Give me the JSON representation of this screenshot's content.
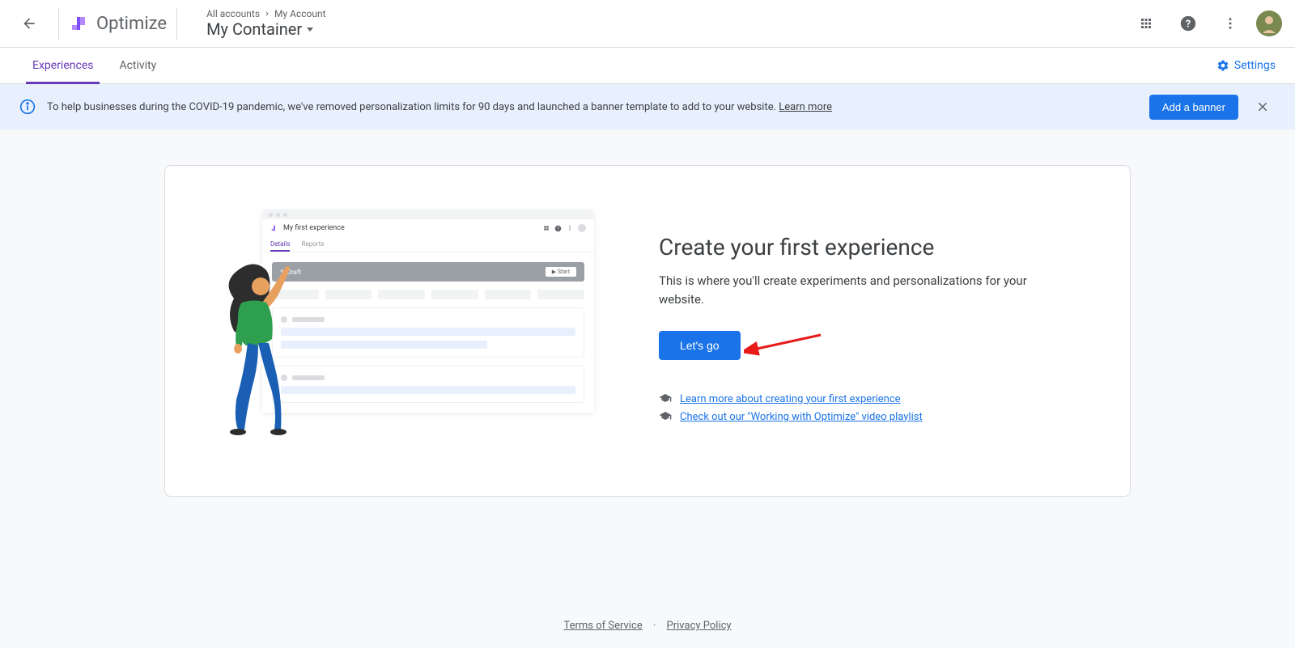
{
  "header": {
    "logo_text": "Optimize",
    "breadcrumb_all": "All accounts",
    "breadcrumb_account": "My Account",
    "container_name": "My Container"
  },
  "tabs": {
    "experiences": "Experiences",
    "activity": "Activity",
    "settings": "Settings"
  },
  "banner": {
    "text": "To help businesses during the COVID-19 pandemic, we've removed personalization limits for 90 days and launched a banner template to add to your website. ",
    "learn_more": "Learn more",
    "add_banner": "Add a banner"
  },
  "card": {
    "title": "Create your first experience",
    "description": "This is where you'll create experiments and personalizations for your website.",
    "button": "Let's go",
    "link1": " Learn more about creating your first experience",
    "link2": " Check out our \"Working with Optimize\" video playlist"
  },
  "mock": {
    "title": "My first experience",
    "tab1": "Details",
    "tab2": "Reports",
    "draft": "Draft",
    "start": "▶ Start"
  },
  "footer": {
    "terms": "Terms of Service",
    "privacy": "Privacy Policy"
  }
}
